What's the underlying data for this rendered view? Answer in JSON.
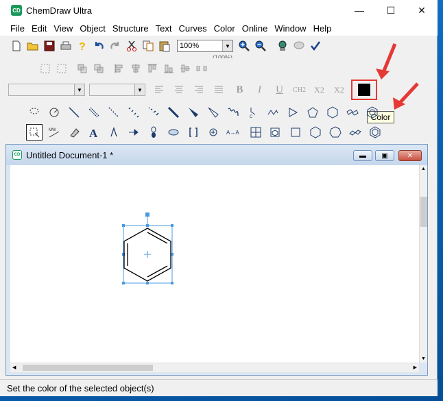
{
  "app": {
    "title": "ChemDraw Ultra",
    "icon_text": "CD"
  },
  "window_controls": {
    "minimize": "—",
    "maximize": "☐",
    "close": "✕"
  },
  "menu": [
    "File",
    "Edit",
    "View",
    "Object",
    "Structure",
    "Text",
    "Curves",
    "Color",
    "Online",
    "Window",
    "Help"
  ],
  "toolbar": {
    "zoom_value": "100%",
    "zoom_partial_below": "(100%)",
    "format_buttons": [
      "B",
      "I",
      "U",
      "CH2",
      "X2",
      "X2"
    ],
    "color_tooltip": "Color"
  },
  "document": {
    "title": "Untitled Document-1 *",
    "icon_text": "CD"
  },
  "status": {
    "text": "Set the color of the selected object(s)"
  },
  "colors": {
    "accent_red": "#e53935",
    "selection_blue": "#4a9ae0",
    "swatch": "#000000"
  }
}
